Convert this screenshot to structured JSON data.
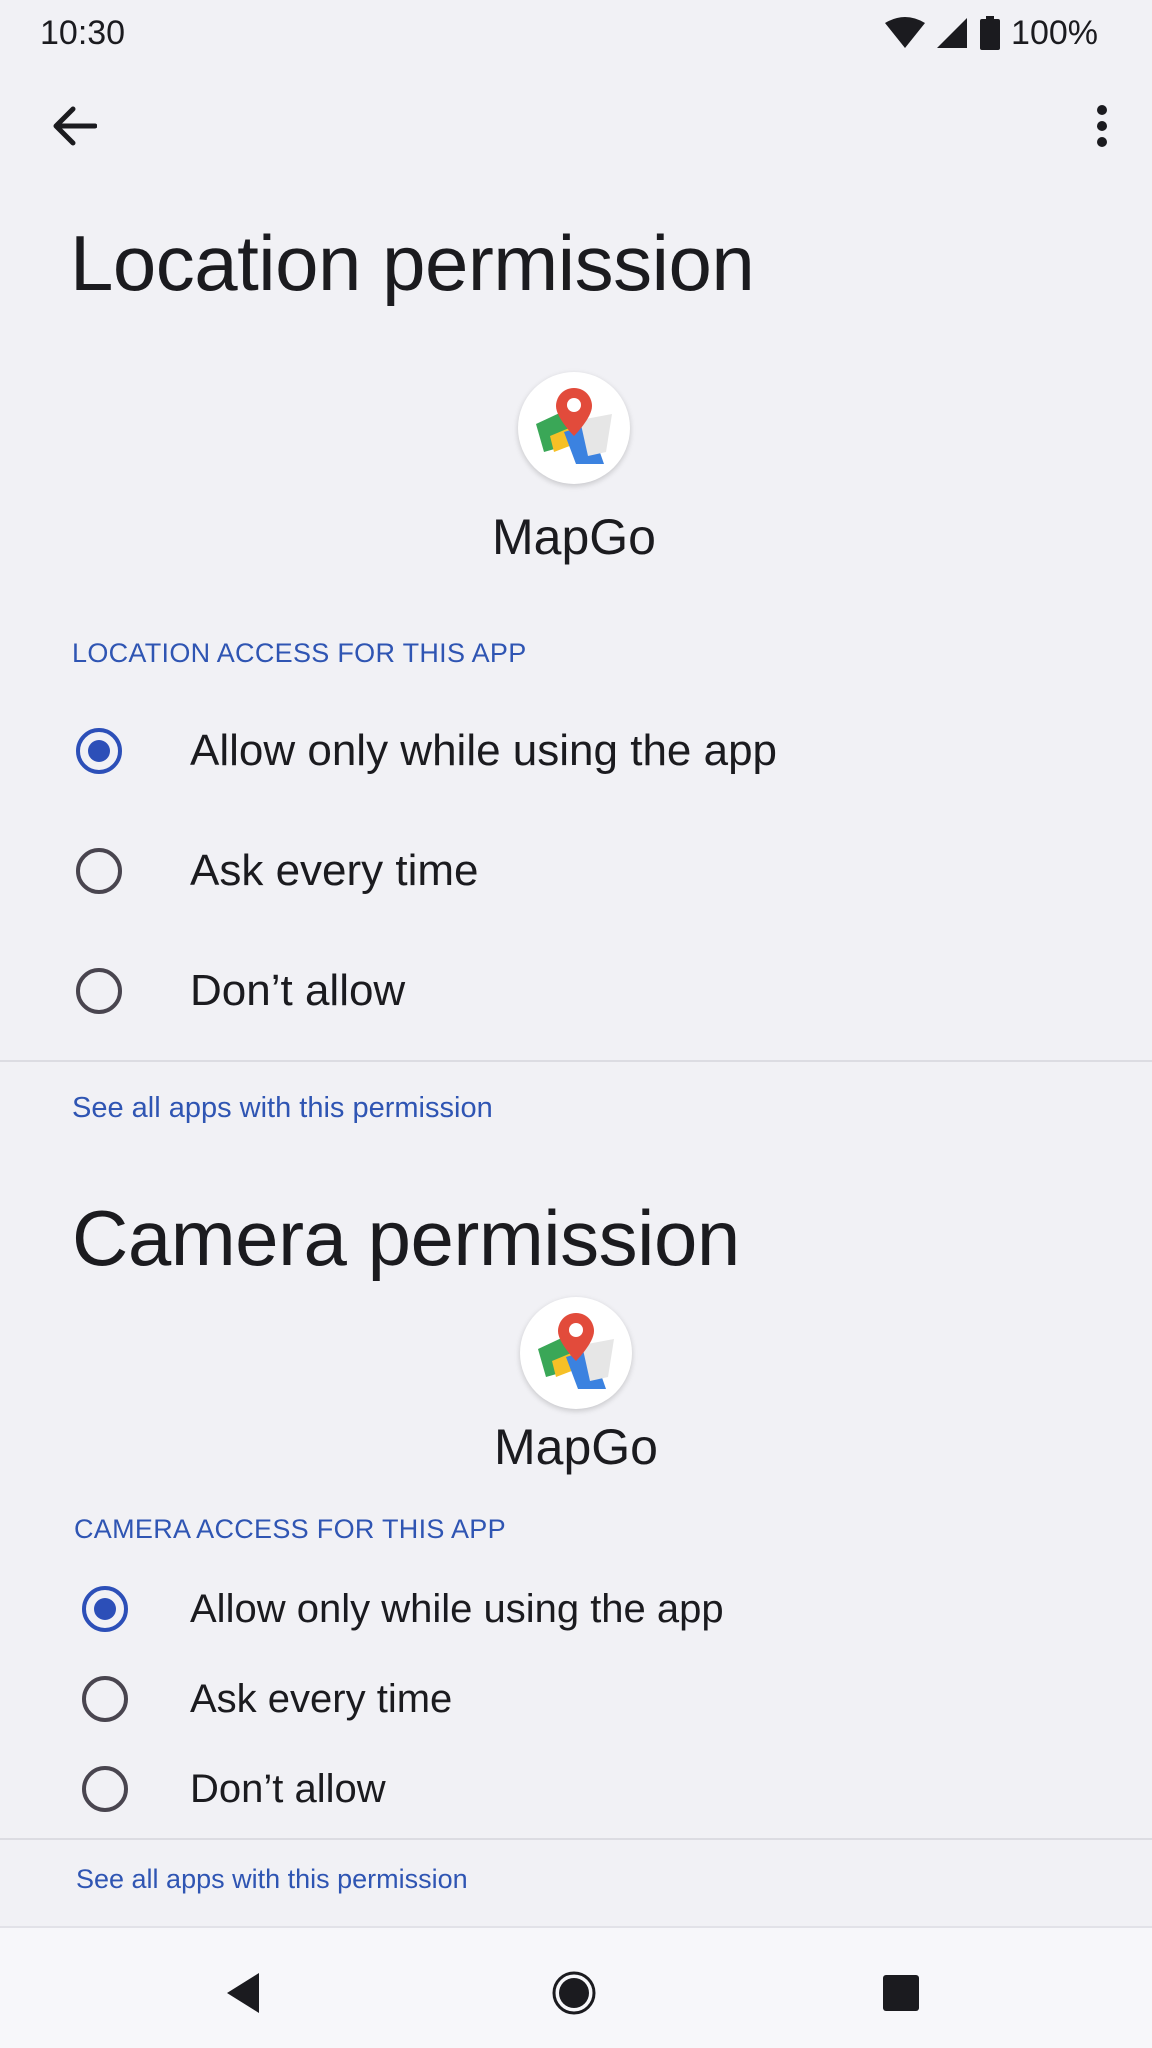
{
  "status_bar": {
    "time": "10:30",
    "battery": "100%",
    "icons": [
      "wifi-icon",
      "cell-signal-icon",
      "battery-icon"
    ]
  },
  "toolbar": {
    "back_icon": "arrow-back-icon",
    "more_icon": "more-vert-icon"
  },
  "sections": [
    {
      "title": "Location permission",
      "app_name": "MapGo",
      "header": "LOCATION ACCESS FOR THIS APP",
      "options": [
        {
          "label": "Allow only while using the app",
          "checked": true
        },
        {
          "label": "Ask every time",
          "checked": false
        },
        {
          "label": "Don’t allow",
          "checked": false
        }
      ],
      "link": "See all apps with this permission"
    },
    {
      "title": "Camera permission",
      "app_name": "MapGo",
      "header": "CAMERA ACCESS FOR THIS APP",
      "options": [
        {
          "label": "Allow only while using the app",
          "checked": true
        },
        {
          "label": "Ask every time",
          "checked": false
        },
        {
          "label": "Don’t allow",
          "checked": false
        }
      ],
      "link": "See all apps with this permission"
    }
  ],
  "nav_bar": {
    "icons": [
      "nav-back-icon",
      "nav-home-icon",
      "nav-recents-icon"
    ]
  },
  "colors": {
    "accent": "#2c4fb8",
    "background": "#f1f1f5",
    "link": "#2f55b3"
  }
}
